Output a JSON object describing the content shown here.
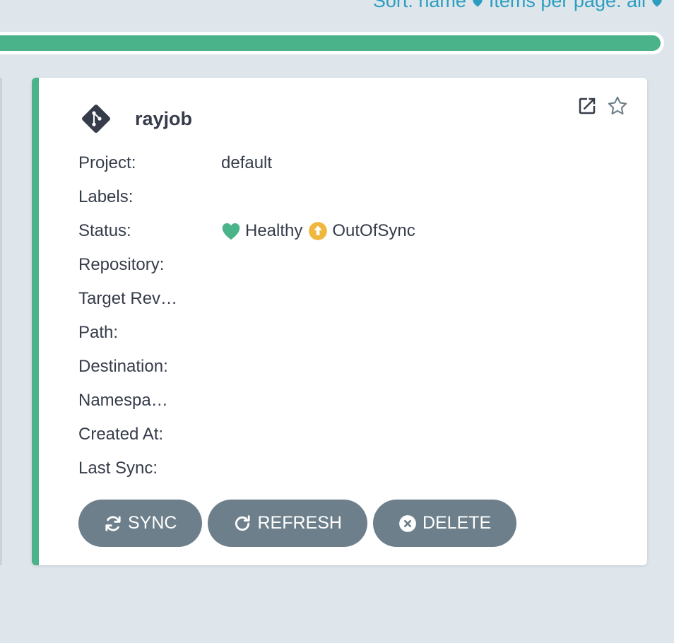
{
  "sort_bar": {
    "sort_label": "Sort: name",
    "items_label": "Items per page: all"
  },
  "progress": {
    "fill_percent": 100,
    "color": "#4bb38a"
  },
  "app": {
    "name": "rayjob",
    "fields": [
      {
        "label": "Project:",
        "value": "default"
      },
      {
        "label": "Labels:",
        "value": ""
      },
      {
        "label": "Status:",
        "value": ""
      },
      {
        "label": "Repository:",
        "value": ""
      },
      {
        "label": "Target Rev…",
        "value": ""
      },
      {
        "label": "Path:",
        "value": ""
      },
      {
        "label": "Destination:",
        "value": ""
      },
      {
        "label": "Namespa…",
        "value": ""
      },
      {
        "label": "Created At:",
        "value": ""
      },
      {
        "label": "Last Sync:",
        "value": ""
      }
    ],
    "health_status": "Healthy",
    "sync_status": "OutOfSync",
    "health_color": "#4bb38a",
    "sync_color": "#f0b73f"
  },
  "buttons": {
    "sync": "SYNC",
    "refresh": "REFRESH",
    "delete": "DELETE"
  },
  "icons": {
    "git": "git-icon",
    "external_link": "external-link-icon",
    "favorite": "star-icon",
    "heart": "heart-icon",
    "out_of_sync": "arrow-up-circle-icon",
    "sync": "sync-icon",
    "refresh": "refresh-icon",
    "delete": "times-circle-icon"
  }
}
